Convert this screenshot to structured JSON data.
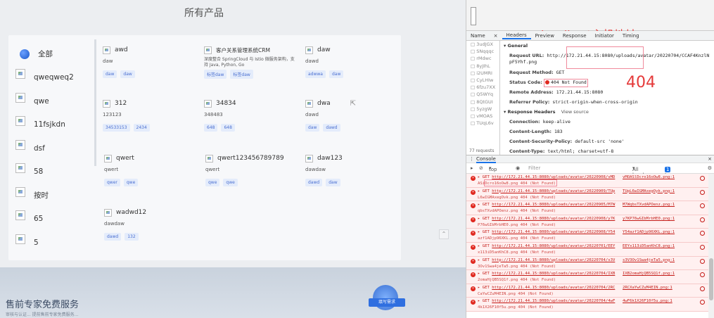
{
  "page": {
    "title": "所有产品",
    "categories": [
      {
        "label": "全部",
        "icon": "globe-icon"
      },
      {
        "label": "qweqweq2",
        "icon": "image-icon"
      },
      {
        "label": "qwe",
        "icon": "image-icon"
      },
      {
        "label": "11fsjkdn",
        "icon": "image-icon"
      },
      {
        "label": "dsf",
        "icon": "image-icon"
      },
      {
        "label": "58",
        "icon": "image-icon"
      },
      {
        "label": "按时",
        "icon": "image-icon"
      },
      {
        "label": "65",
        "icon": "image-icon"
      },
      {
        "label": "5",
        "icon": "image-icon"
      }
    ],
    "products": [
      {
        "name": "awd",
        "desc": "daw",
        "tags": [
          "daw",
          "daw"
        ]
      },
      {
        "name": "客户关系管理系统CRM",
        "desc": "深度整合 SpringCloud 与 Istio 微服务架构，支持 Java, Python, Go",
        "tags": [
          "标签daw",
          "标签daw"
        ]
      },
      {
        "name": "daw",
        "desc": "dawd",
        "tags": [
          "adwwa",
          "daw"
        ]
      },
      {
        "name": "312",
        "desc": "123123",
        "tags": [
          "34533153",
          "2434"
        ]
      },
      {
        "name": "34834",
        "desc": "348483",
        "tags": [
          "648",
          "648"
        ]
      },
      {
        "name": "dwa",
        "desc": "dawd",
        "tags": [
          "daw",
          "dawd"
        ]
      },
      {
        "name": "qwert",
        "desc": "qwert",
        "tags": [
          "qwer",
          "qwe"
        ]
      },
      {
        "name": "qwert123456789789",
        "desc": "qwert",
        "tags": [
          "qwe",
          "qwe"
        ]
      },
      {
        "name": "daw123",
        "desc": "dawdaw",
        "tags": [
          "dawd",
          "daw"
        ]
      },
      {
        "name": "wadwd12",
        "desc": "dawdaw",
        "tags": [
          "dawd",
          "132"
        ]
      }
    ],
    "banner_title": "售前专家免费服务",
    "banner_sub": "审核与认证... 提前售前专家免费服务...",
    "banner_button": "填写需求"
  },
  "devtools": {
    "annotation_title": "localhost主机地址",
    "annotation_404": "404",
    "tabs": [
      "Name",
      "×",
      "Headers",
      "Preview",
      "Response",
      "Initiator",
      "Timing"
    ],
    "request_names": [
      "3udJGX",
      "SNqqqc",
      "rMdwc",
      "8yJIhL",
      "i2UMRI",
      "CyLHIw",
      "6fzu7XX",
      "Q5WYq",
      "8QtGUI",
      "5yzgW",
      "vMOAS",
      "TUqL6v"
    ],
    "request_count": "77 requests",
    "general_label": "General",
    "request_url_label": "Request URL:",
    "request_url": "http://172.21.44.15:8080/uploads/avatar/20220704/CCAF4KnzlNpF5Yhf.png",
    "request_method_label": "Request Method:",
    "request_method": "GET",
    "status_code_label": "Status Code:",
    "status_code": "404 Not Found",
    "remote_address_label": "Remote Address:",
    "remote_address": "172.21.44.15:8080",
    "referrer_label": "Referrer Policy:",
    "referrer": "strict-origin-when-cross-origin",
    "response_headers_label": "Response Headers",
    "view_source": "View source",
    "connection_label": "Connection:",
    "connection": "keep-alive",
    "content_length_label": "Content-Length:",
    "content_length": "183",
    "csp_label": "Content-Security-Policy:",
    "csp": "default-src 'none'",
    "content_type_label": "Content-Type:",
    "content_type": "text/html; charset=utf-8",
    "console_tab": "Console",
    "top_select": "top",
    "filter_placeholder": "Filter",
    "levels": "All levels",
    "issue": "1 Issue:",
    "issue_count": "1",
    "logs": [
      {
        "url": "http://172.21.44.15:8080/uploads/avatar/20220908/vMD",
        "tail": "vMOASlDcro16oOw8.png:1",
        "sub": "ASiDcro16oOw8.png 404 (Not Found)"
      },
      {
        "url": "http://172.21.44.15:8080/uploads/avatar/20220909/TUp",
        "tail": "TUpL6wIGMAxegOyk.png:1",
        "sub": "L6wIGMAxegOvk.png 404 (Not Found)"
      },
      {
        "url": "http://172.21.44.15:8080/uploads/avatar/20220905/M7W",
        "tail": "M7WqbsTXvdAPOenz.png:1",
        "sub": "qbsTXvdAPOenz.png 404 (Not Found)"
      },
      {
        "url": "http://172.21.44.15:8080/uploads/avatar/20220908/y7K",
        "tail": "y7KP76wGIbMrbHE0.png:1",
        "sub": "P76wGIbMrbHE0.png 404 (Not Found)"
      },
      {
        "url": "http://172.21.44.15:8080/uploads/avatar/20220908/Y54",
        "tail": "Y54azf1ADjp96XKL.png:1",
        "sub": "azf1ADjp96XKL.png 404 (Not Found)"
      },
      {
        "url": "http://172.21.44.15:8080/uploads/avatar/20220701/EEY",
        "tail": "EEYx113iD5anKhC8.png:1",
        "sub": "x113iD5anKhC8.png 404 (Not Found)"
      },
      {
        "url": "http://172.21.44.15:8080/uploads/avatar/20220704/s3V",
        "tail": "s3V3Ov1Swa4jeTa5.png:1",
        "sub": "3Ov1Swa4jeTa5.png 404 (Not Found)"
      },
      {
        "url": "http://172.21.44.15:8080/uploads/avatar/20220704/IXB",
        "tail": "IXB2omaHjQB5SQ1f.png:1",
        "sub": "2omaHjQB5SQ1f.png 404 (Not Found)"
      },
      {
        "url": "http://172.21.44.15:8080/uploads/avatar/20220704/2RC",
        "tail": "2RCXaYwCZuM4EIN.png:1",
        "sub": "CaYwCZuM4EIN.png 404 (Not Found)"
      },
      {
        "url": "http://172.21.44.15:8080/uploads/avatar/20220704/4wF",
        "tail": "4wF6k1X26F10f5u.png:1",
        "sub": "4k1X26F10f5u.png 404 (Not Found)"
      }
    ]
  },
  "colors": {
    "accent": "#1a73e8",
    "error": "#e0281f",
    "annotation": "#e53a3a"
  }
}
